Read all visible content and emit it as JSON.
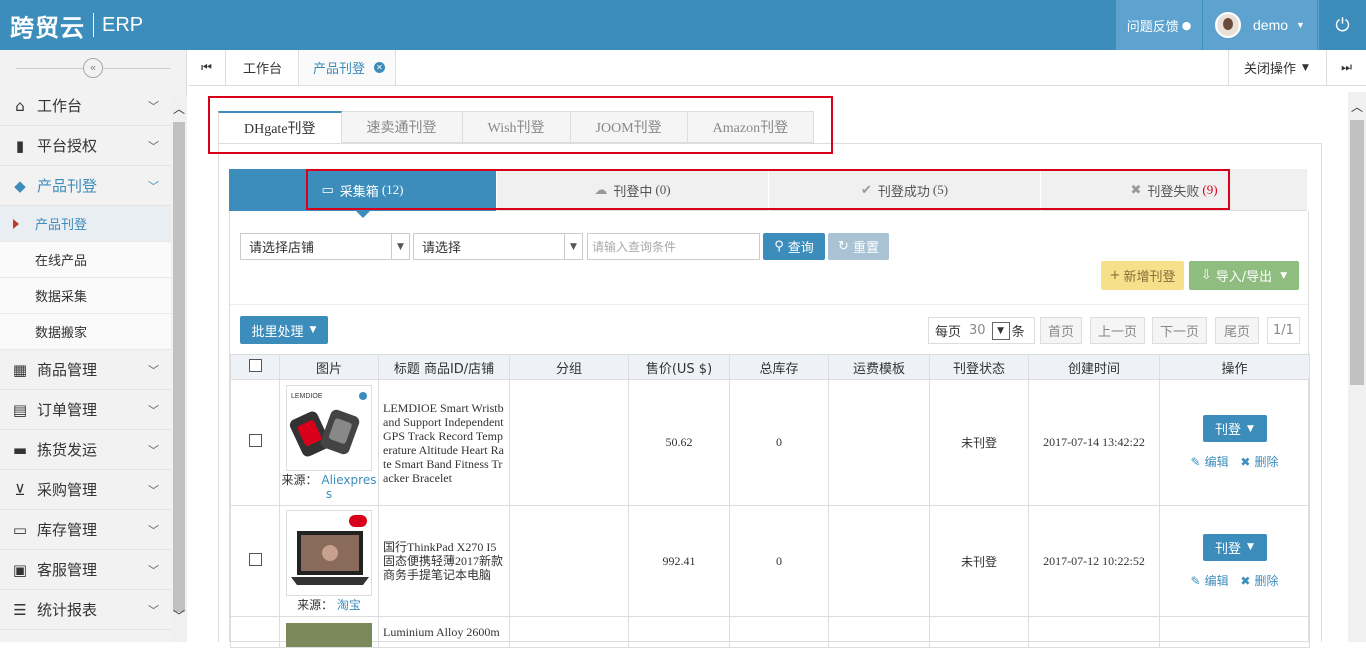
{
  "header": {
    "brand": "跨贸云",
    "product": "ERP",
    "feedback": "问题反馈",
    "user": "demo"
  },
  "sidebar": {
    "collapse_glyph": "«",
    "items": [
      {
        "label": "工作台",
        "icon": "home-icon",
        "glyph": "⌂"
      },
      {
        "label": "平台授权",
        "icon": "bookmark-icon",
        "glyph": "▮"
      },
      {
        "label": "产品刊登",
        "icon": "cube-icon",
        "glyph": "◆"
      },
      {
        "label": "商品管理",
        "icon": "gift-icon",
        "glyph": "▦"
      },
      {
        "label": "订单管理",
        "icon": "file-icon",
        "glyph": "▤"
      },
      {
        "label": "拣货发运",
        "icon": "truck-icon",
        "glyph": "▬"
      },
      {
        "label": "采购管理",
        "icon": "cart-icon",
        "glyph": "⊻"
      },
      {
        "label": "库存管理",
        "icon": "inbox-icon",
        "glyph": "▭"
      },
      {
        "label": "客服管理",
        "icon": "briefcase-icon",
        "glyph": "▣"
      },
      {
        "label": "统计报表",
        "icon": "list-icon",
        "glyph": "☰"
      }
    ],
    "subitems": [
      "产品刊登",
      "在线产品",
      "数据采集",
      "数据搬家"
    ]
  },
  "tabs": {
    "items": [
      "工作台",
      "产品刊登"
    ],
    "close_ops": "关闭操作"
  },
  "platform_tabs": [
    "DHgate刊登",
    "速卖通刊登",
    "Wish刊登",
    "JOOM刊登",
    "Amazon刊登"
  ],
  "status_tabs": [
    {
      "label": "采集箱",
      "count": "(12)"
    },
    {
      "label": "刊登中",
      "count": "(0)"
    },
    {
      "label": "刊登成功",
      "count": "(5)"
    },
    {
      "label": "刊登失败",
      "count": "(9)"
    }
  ],
  "filters": {
    "store_select": "请选择店铺",
    "select": "请选择",
    "search_placeholder": "请输入查询条件",
    "query": "查询",
    "reset": "重置",
    "add": "新增刊登",
    "import_export": "导入/导出",
    "batch": "批里处理"
  },
  "pager": {
    "per_page_label": "每页",
    "per_page_value": "30",
    "unit": "条",
    "first": "首页",
    "prev": "上一页",
    "next": "下一页",
    "last": "尾页",
    "page": "1/1"
  },
  "table": {
    "headers": [
      "图片",
      "标题 商品ID/店铺",
      "分组",
      "售价(US $)",
      "总库存",
      "运费模板",
      "刊登状态",
      "创建时间",
      "操作"
    ],
    "rows": [
      {
        "title": "LEMDIOE Smart Wristband Support Independent GPS Track Record Temperature Altitude Heart Rate Smart Band Fitness Tracker Bracelet",
        "source_label": "来源：",
        "source": "Aliexpress",
        "price": "50.62",
        "stock": "0",
        "status": "未刊登",
        "created": "2017-07-14 13:42:22",
        "action": "刊登",
        "edit": "编辑",
        "delete": "删除"
      },
      {
        "title": "国行ThinkPad X270 I5 固态便携轻薄2017新款商务手提笔记本电脑",
        "source_label": "来源：",
        "source": "淘宝",
        "price": "992.41",
        "stock": "0",
        "status": "未刊登",
        "created": "2017-07-12 10:22:52",
        "action": "刊登",
        "edit": "编辑",
        "delete": "删除"
      },
      {
        "title": "Luminium Alloy 2600m"
      }
    ]
  },
  "colors": {
    "primary": "#3c8dbc",
    "highlight": "#d9001b",
    "warning": "#f7e08a",
    "success": "#8fbc7f"
  }
}
